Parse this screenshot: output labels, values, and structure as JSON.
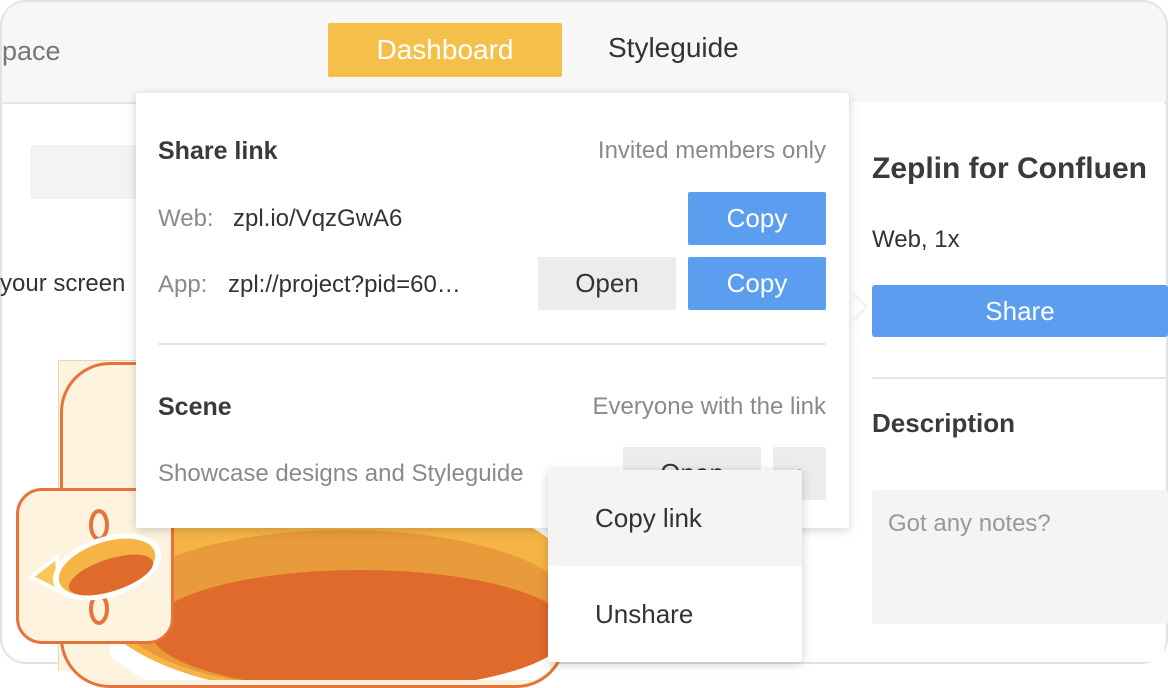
{
  "topbar": {
    "workspace_partial": "pace",
    "tabs": [
      {
        "label": "Dashboard",
        "active": true
      },
      {
        "label": "Styleguide",
        "active": false
      }
    ]
  },
  "background": {
    "screens_text_partial": "your screen"
  },
  "sidebar": {
    "project_title": "Zeplin for Confluen",
    "project_subtitle": "Web, 1x",
    "share_label": "Share",
    "description_label": "Description",
    "notes_placeholder": "Got any notes?"
  },
  "popover": {
    "share_link": {
      "title": "Share link",
      "access": "Invited members only",
      "web_label": "Web:",
      "web_value": "zpl.io/VqzGwA6",
      "app_label": "App:",
      "app_value": "zpl://project?pid=60…",
      "open_label": "Open",
      "copy_label": "Copy"
    },
    "scene": {
      "title": "Scene",
      "access": "Everyone with the link",
      "description": "Showcase designs and Styleguide",
      "open_label": "Open",
      "more_label": "•"
    }
  },
  "menu": {
    "items": [
      {
        "label": "Copy link",
        "hover": true
      },
      {
        "label": "Unshare",
        "hover": false
      }
    ]
  },
  "colors": {
    "accent_yellow": "#f5c04a",
    "accent_blue": "#5b9ef0",
    "brand_orange": "#e7733a"
  }
}
